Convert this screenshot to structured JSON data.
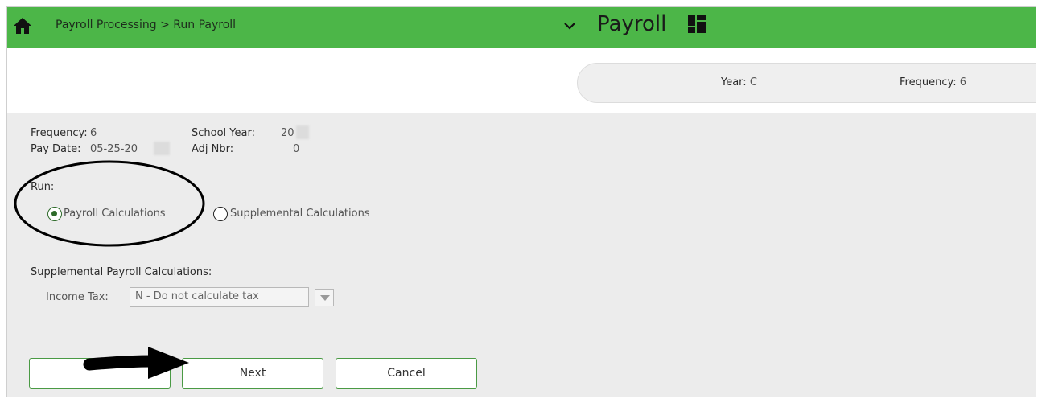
{
  "header": {
    "breadcrumb": "Payroll Processing > Run Payroll",
    "app_title": "Payroll",
    "bar_color": "#4cb648"
  },
  "infobar": {
    "year_label": "Year:",
    "year_value": "C",
    "frequency_label": "Frequency:",
    "frequency_value": "6"
  },
  "summary": {
    "frequency_label": "Frequency:",
    "frequency_value": "6",
    "school_year_label": "School Year:",
    "school_year_value": "20",
    "pay_date_label": "Pay Date:",
    "pay_date_value": "05-25-20",
    "adj_nbr_label": "Adj Nbr:",
    "adj_nbr_value": "0"
  },
  "run": {
    "label": "Run:",
    "options": [
      {
        "label": "Payroll Calculations",
        "selected": true
      },
      {
        "label": "Supplemental Calculations",
        "selected": false
      }
    ]
  },
  "supplemental": {
    "section_title": "Supplemental Payroll Calculations:",
    "income_tax_label": "Income Tax:",
    "income_tax_value": "N - Do not calculate tax"
  },
  "buttons": {
    "next_label": "Next",
    "cancel_label": "Cancel",
    "accent_color": "#4a9a44"
  }
}
